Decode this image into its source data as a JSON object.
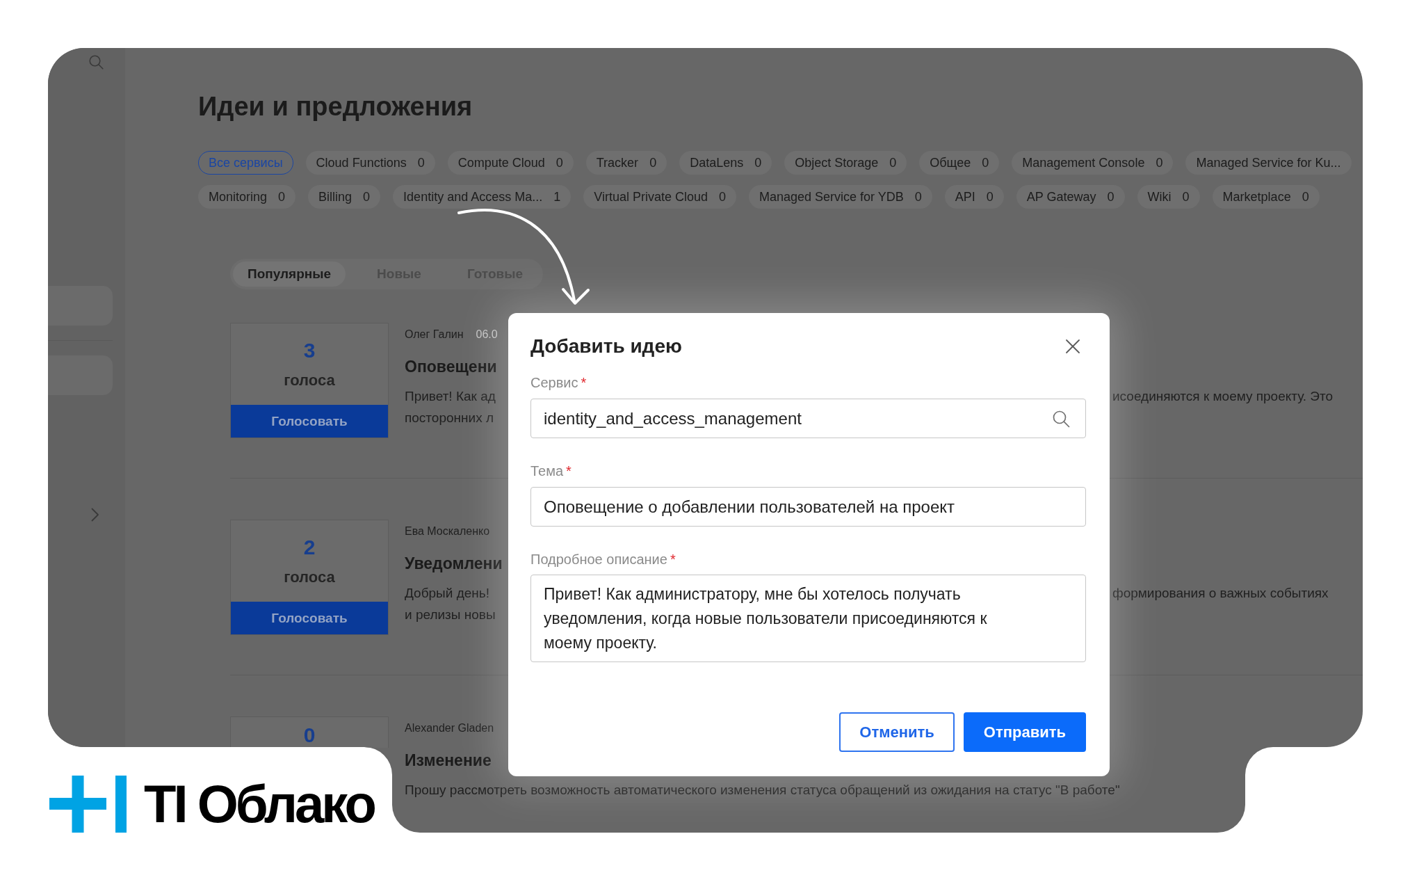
{
  "page": {
    "title": "Идеи и предложения"
  },
  "service_filters": [
    [
      {
        "label": "Все сервисы",
        "selected": true
      },
      {
        "label": "Cloud Functions",
        "count": "0",
        "selected": false
      },
      {
        "label": "Compute Cloud",
        "count": "0",
        "selected": false
      },
      {
        "label": "Tracker",
        "count": "0",
        "selected": false
      },
      {
        "label": "DataLens",
        "count": "0",
        "selected": false
      },
      {
        "label": "Object Storage",
        "count": "0",
        "selected": false
      },
      {
        "label": "Общее",
        "count": "0",
        "selected": false
      },
      {
        "label": "Management Console",
        "count": "0",
        "selected": false
      },
      {
        "label": "Managed Service for Ku...",
        "selected": false
      }
    ],
    [
      {
        "label": "Monitoring",
        "count": "0",
        "selected": false
      },
      {
        "label": "Billing",
        "count": "0",
        "selected": false
      },
      {
        "label": "Identity and Access Ma...",
        "count": "1",
        "selected": false
      },
      {
        "label": "Virtual Private Cloud",
        "count": "0",
        "selected": false
      },
      {
        "label": "Managed Service for YDB",
        "count": "0",
        "selected": false
      },
      {
        "label": "API",
        "count": "0",
        "selected": false
      },
      {
        "label": "AP Gateway",
        "count": "0",
        "selected": false
      },
      {
        "label": "Wiki",
        "count": "0",
        "selected": false
      },
      {
        "label": "Marketplace",
        "count": "0",
        "selected": false
      }
    ]
  ],
  "sort_tabs": [
    {
      "label": "Популярные",
      "selected": true
    },
    {
      "label": "Новые",
      "selected": false
    },
    {
      "label": "Готовые",
      "selected": false
    }
  ],
  "ideas": [
    {
      "votes": "3",
      "votes_label": "голоса",
      "vote_button": "Голосовать",
      "author": "Олег Галин",
      "date": "06.0",
      "title": "Оповещени",
      "description_lines": [
        [
          "Привет! Как ад",
          "исоединяются к моему проекту. Это"
        ],
        [
          "посторонних л"
        ]
      ]
    },
    {
      "votes": "2",
      "votes_label": "голоса",
      "vote_button": "Голосовать",
      "author": "Ева Москаленко",
      "title": "Уведомлени",
      "description_lines": [
        [
          "Добрый день!",
          "формирования о важных событиях"
        ],
        [
          "и релизы новы"
        ]
      ]
    },
    {
      "votes": "0",
      "author": "Alexander Gladen",
      "title": "Изменение",
      "description_lines": [
        [
          "Прошу рассмотреть возможность автоматического изменения статуса обращений из ожидания на статус \"В работе\""
        ]
      ]
    }
  ],
  "dialog": {
    "title": "Добавить идею",
    "fields": [
      {
        "kind": "search",
        "label": "Сервис",
        "required_mark": "*",
        "value": "identity_and_access_management"
      },
      {
        "kind": "text",
        "label": "Тема",
        "required_mark": "*",
        "value": "Оповещение о добавлении пользователей на проект"
      },
      {
        "kind": "textarea",
        "label": "Подробное описание",
        "required_mark": "*",
        "value": "Привет! Как администратору, мне бы хотелось получать уведомления, когда новые пользователи присоединяются к моему проекту."
      }
    ],
    "buttons": [
      {
        "kind": "secondary",
        "label": "Отменить"
      },
      {
        "kind": "primary",
        "label": "Отправить"
      }
    ]
  },
  "brand": {
    "name": "TI Облако"
  }
}
